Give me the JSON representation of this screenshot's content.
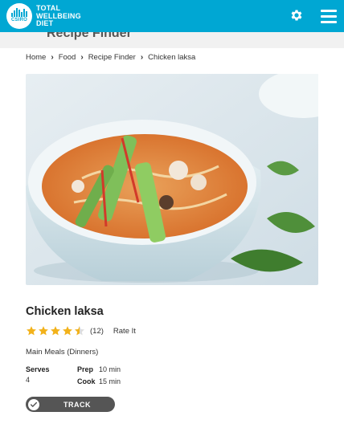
{
  "header": {
    "logo_text": "CSIRO",
    "brand_line1": "TOTAL",
    "brand_line2": "WELLBEING",
    "brand_line3": "DIET",
    "accent_color": "#00a7d3"
  },
  "subbar": {
    "clipped_title": "Recipe Finder"
  },
  "breadcrumb": {
    "items": [
      "Home",
      "Food",
      "Recipe Finder",
      "Chicken laksa"
    ]
  },
  "recipe": {
    "image_alt": "Chicken laksa",
    "title": "Chicken laksa",
    "rating_value": 4.5,
    "rating_max": 5,
    "rating_count": "(12)",
    "rate_it": "Rate It",
    "category": "Main Meals (Dinners)",
    "serves_label": "Serves",
    "serves_value": "4",
    "prep_label": "Prep",
    "prep_value": "10 min",
    "cook_label": "Cook",
    "cook_value": "15 min",
    "track_label": "TRACK"
  },
  "icons": {
    "settings": "gear-icon",
    "menu": "hamburger-menu-icon",
    "breadcrumb_sep": "chevron-right-icon",
    "star": "star-icon",
    "track": "check-circle-icon"
  }
}
